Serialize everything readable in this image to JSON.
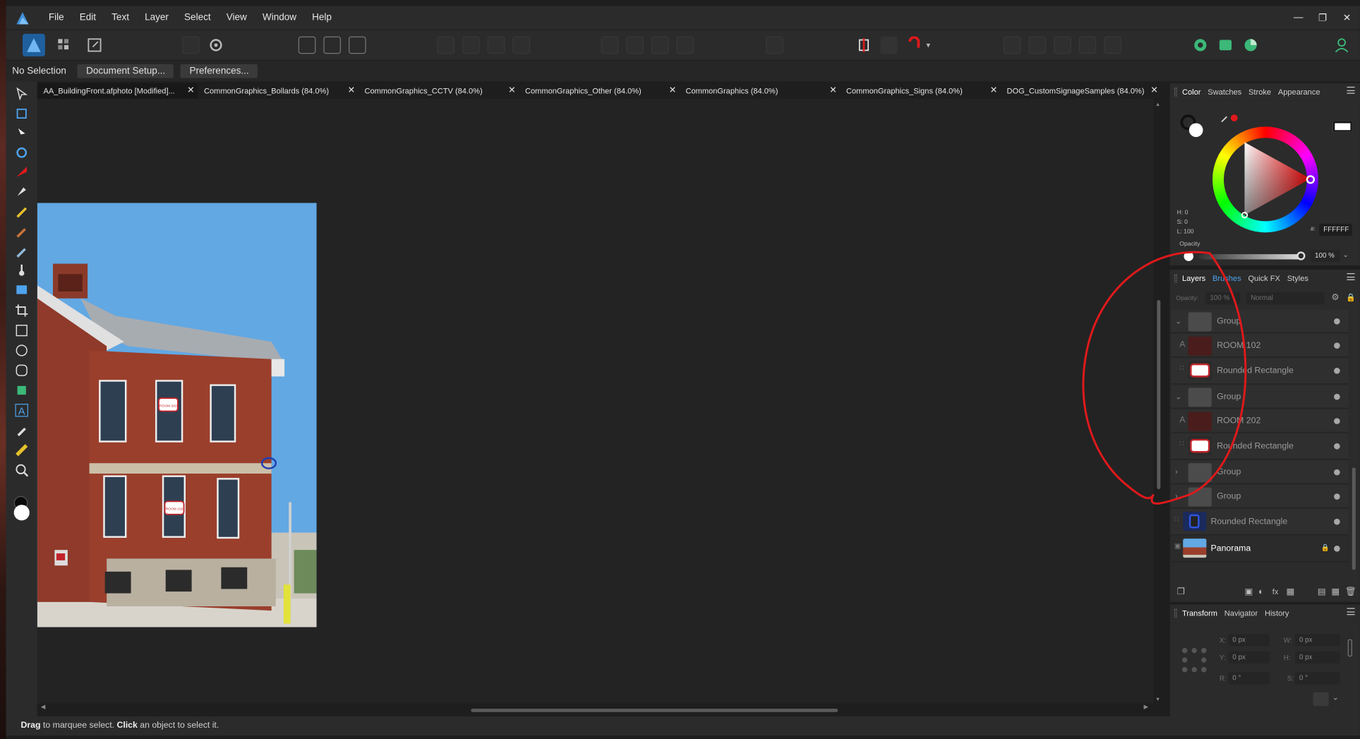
{
  "menubar": {
    "items": [
      "File",
      "Edit",
      "Text",
      "Layer",
      "Select",
      "View",
      "Window",
      "Help"
    ],
    "window_controls": [
      "minimize",
      "restore",
      "close"
    ]
  },
  "contextbar": {
    "selection_label": "No Selection",
    "document_setup": "Document Setup...",
    "preferences": "Preferences..."
  },
  "tabs": [
    {
      "label": "AA_BuildingFront.afphoto [Modified]..."
    },
    {
      "label": "CommonGraphics_Bollards (84.0%)"
    },
    {
      "label": "CommonGraphics_CCTV (84.0%)"
    },
    {
      "label": "CommonGraphics_Other (84.0%)"
    },
    {
      "label": "CommonGraphics (84.0%)"
    },
    {
      "label": "CommonGraphics_Signs (84.0%)"
    },
    {
      "label": "DOG_CustomSignageSamples (84.0%)"
    }
  ],
  "status": {
    "drag": "Drag",
    "drag_text": " to marquee select. ",
    "click": "Click",
    "click_text": " an object to select it."
  },
  "color_panel": {
    "tabs": [
      "Color",
      "Swatches",
      "Stroke",
      "Appearance"
    ],
    "h": "H: 0",
    "s": "S: 0",
    "l": "L: 100",
    "hex_prefix": "#:",
    "hex": "FFFFFF",
    "opacity_label": "Opacity",
    "opacity_value": "100 %"
  },
  "layers_panel": {
    "tabs": [
      "Layers",
      "Brushes",
      "Quick FX",
      "Styles"
    ],
    "opacity_label": "Opacity:",
    "opacity_value": "100 %",
    "blend_mode": "Normal",
    "layers": [
      {
        "name": "Group",
        "type": "group",
        "expanded": true
      },
      {
        "name": "ROOM 102",
        "type": "text"
      },
      {
        "name": "Rounded Rectangle",
        "type": "shape"
      },
      {
        "name": "Group",
        "type": "group",
        "expanded": true
      },
      {
        "name": "ROOM 202",
        "type": "text"
      },
      {
        "name": "Rounded Rectangle",
        "type": "shape"
      },
      {
        "name": "Group",
        "type": "group",
        "expanded": false
      },
      {
        "name": "Group",
        "type": "group",
        "expanded": false
      },
      {
        "name": "Rounded Rectangle",
        "type": "shape-blue"
      },
      {
        "name": "Panorama",
        "type": "image",
        "locked": true
      }
    ]
  },
  "transform_panel": {
    "tabs": [
      "Transform",
      "Navigator",
      "History"
    ],
    "x_label": "X:",
    "x": "0 px",
    "y_label": "Y:",
    "y": "0 px",
    "w_label": "W:",
    "w": "0 px",
    "h_label": "H:",
    "h": "0 px",
    "r_label": "R:",
    "r": "0 °",
    "s_label": "S:",
    "s": "0 °"
  },
  "photo_signs": {
    "upper": "ROOM 202",
    "lower": "ROOM 102"
  },
  "colors": {
    "accent_blue": "#3f8fd9",
    "annotation_red": "#e0191b",
    "panel_bg": "#2b2b2b",
    "canvas_bg": "#232323"
  }
}
